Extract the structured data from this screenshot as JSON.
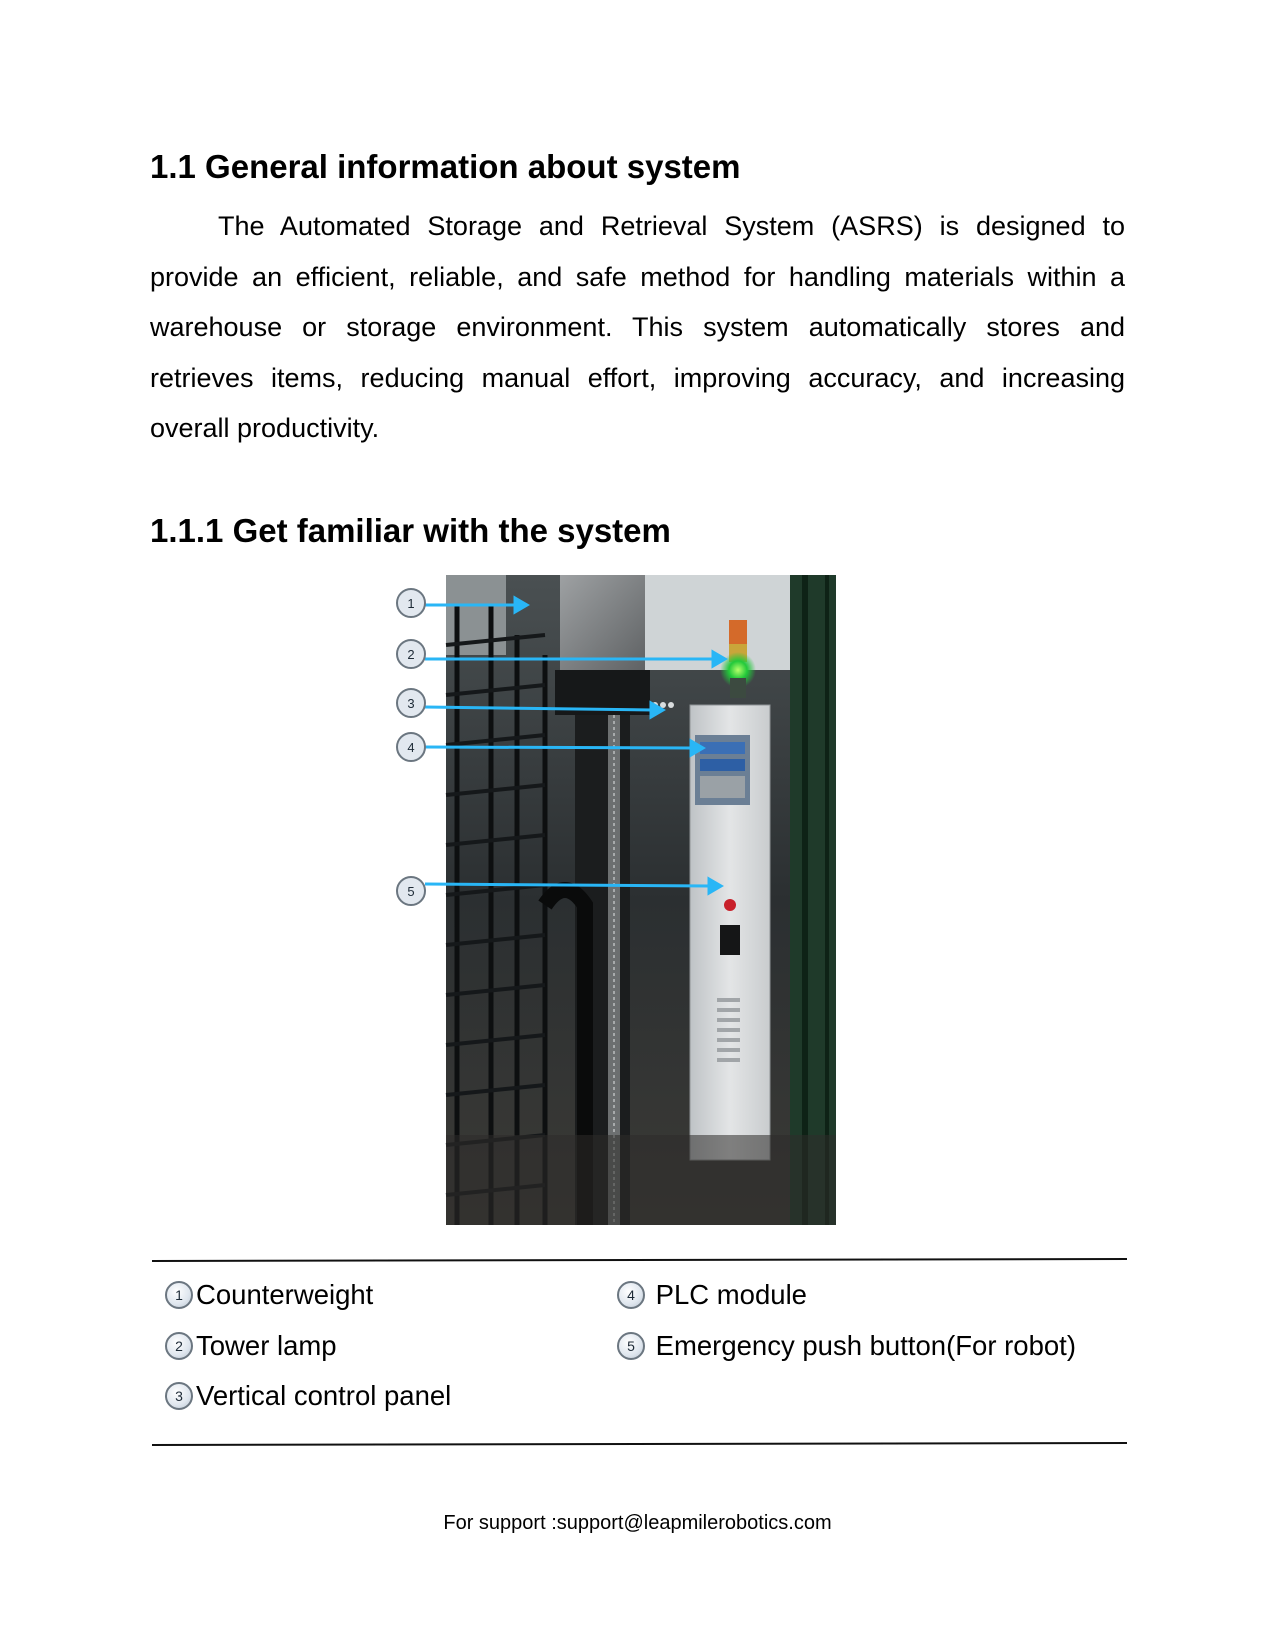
{
  "section_title": "1.1 General information about system",
  "intro_paragraph": "The Automated Storage and Retrieval System (ASRS) is designed to provide an efficient, reliable, and safe method for handling materials within a warehouse or storage environment. This system automatically stores and retrieves items, reducing manual effort, improving accuracy, and increasing overall productivity.",
  "subsection_title": "1.1.1 Get familiar with the system",
  "figure": {
    "callouts": [
      "1",
      "2",
      "3",
      "4",
      "5"
    ],
    "arrow_color": "#29b6f6"
  },
  "legend": {
    "items": [
      {
        "number": "1",
        "label": "Counterweight"
      },
      {
        "number": "2",
        "label": "Tower lamp"
      },
      {
        "number": "3",
        "label": "Vertical control panel"
      },
      {
        "number": "4",
        "label": " PLC module"
      },
      {
        "number": "5",
        "label": " Emergency push button(For robot)"
      }
    ]
  },
  "footer": "For support :support@leapmilerobotics.com"
}
